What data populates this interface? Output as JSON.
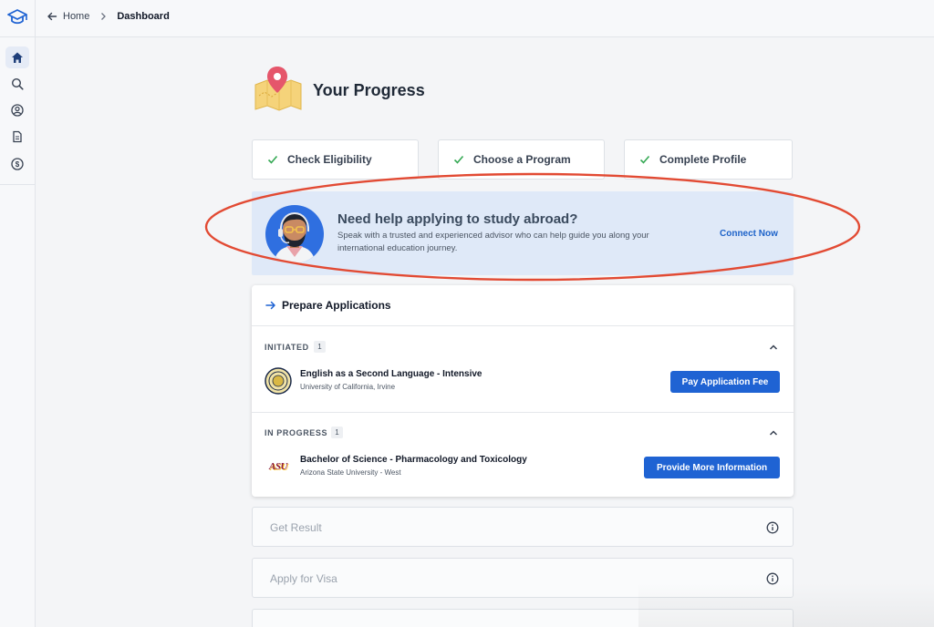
{
  "breadcrumb": {
    "home": "Home",
    "current": "Dashboard"
  },
  "page": {
    "title": "Your Progress"
  },
  "steps": [
    {
      "label": "Check Eligibility",
      "status": "complete"
    },
    {
      "label": "Choose a Program",
      "status": "complete"
    },
    {
      "label": "Complete Profile",
      "status": "complete"
    }
  ],
  "banner": {
    "title": "Need help applying to study abroad?",
    "text": "Speak with a trusted and experienced advisor who can help guide you along your international education journey.",
    "cta": "Connect Now"
  },
  "prepare": {
    "title": "Prepare Applications",
    "groups": [
      {
        "label": "INITIATED",
        "count": "1",
        "program": "English as a Second Language - Intensive",
        "university": "University of California, Irvine",
        "action": "Pay Application Fee"
      },
      {
        "label": "IN PROGRESS",
        "count": "1",
        "program": "Bachelor of Science - Pharmacology and Toxicology",
        "university": "Arizona State University - West",
        "action": "Provide More Information",
        "logo_text": "ASU"
      }
    ]
  },
  "later_steps": [
    {
      "label": "Get Result"
    },
    {
      "label": "Apply for Visa"
    }
  ],
  "colors": {
    "accent": "#1f63d3",
    "banner_bg": "#dfe9f8",
    "check": "#34a853",
    "annotation": "#e24a33"
  },
  "icons": [
    "graduation-cap-icon",
    "home-icon",
    "search-icon",
    "user-circle-icon",
    "document-icon",
    "dollar-icon",
    "back-arrow-icon",
    "chevron-right-icon",
    "map-pin-icon",
    "check-icon",
    "advisor-avatar-icon",
    "arrow-right-icon",
    "chevron-up-icon",
    "uci-seal-icon",
    "asu-logo-icon",
    "info-icon"
  ]
}
